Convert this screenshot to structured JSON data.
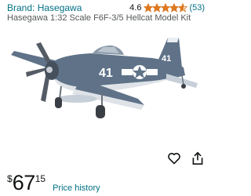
{
  "product": {
    "brand_label": "Brand: Hasegawa",
    "rating_value": "4.6",
    "rating_stars": 4.6,
    "rating_count": "(53)",
    "title": "Hasegawa 1:32 Scale F6F-3/5 Hellcat Model Kit",
    "image_icon": "airplane-model-image",
    "aircraft_number": "41"
  },
  "price": {
    "symbol": "$",
    "whole": "67",
    "fraction": "15",
    "history_link": "Price history"
  },
  "actions": {
    "wishlist_icon": "heart-icon",
    "share_icon": "share-icon"
  },
  "colors": {
    "link": "#007185",
    "star": "#de7921",
    "plane_blue": "#5f7288",
    "plane_light": "#dfe3e8"
  }
}
